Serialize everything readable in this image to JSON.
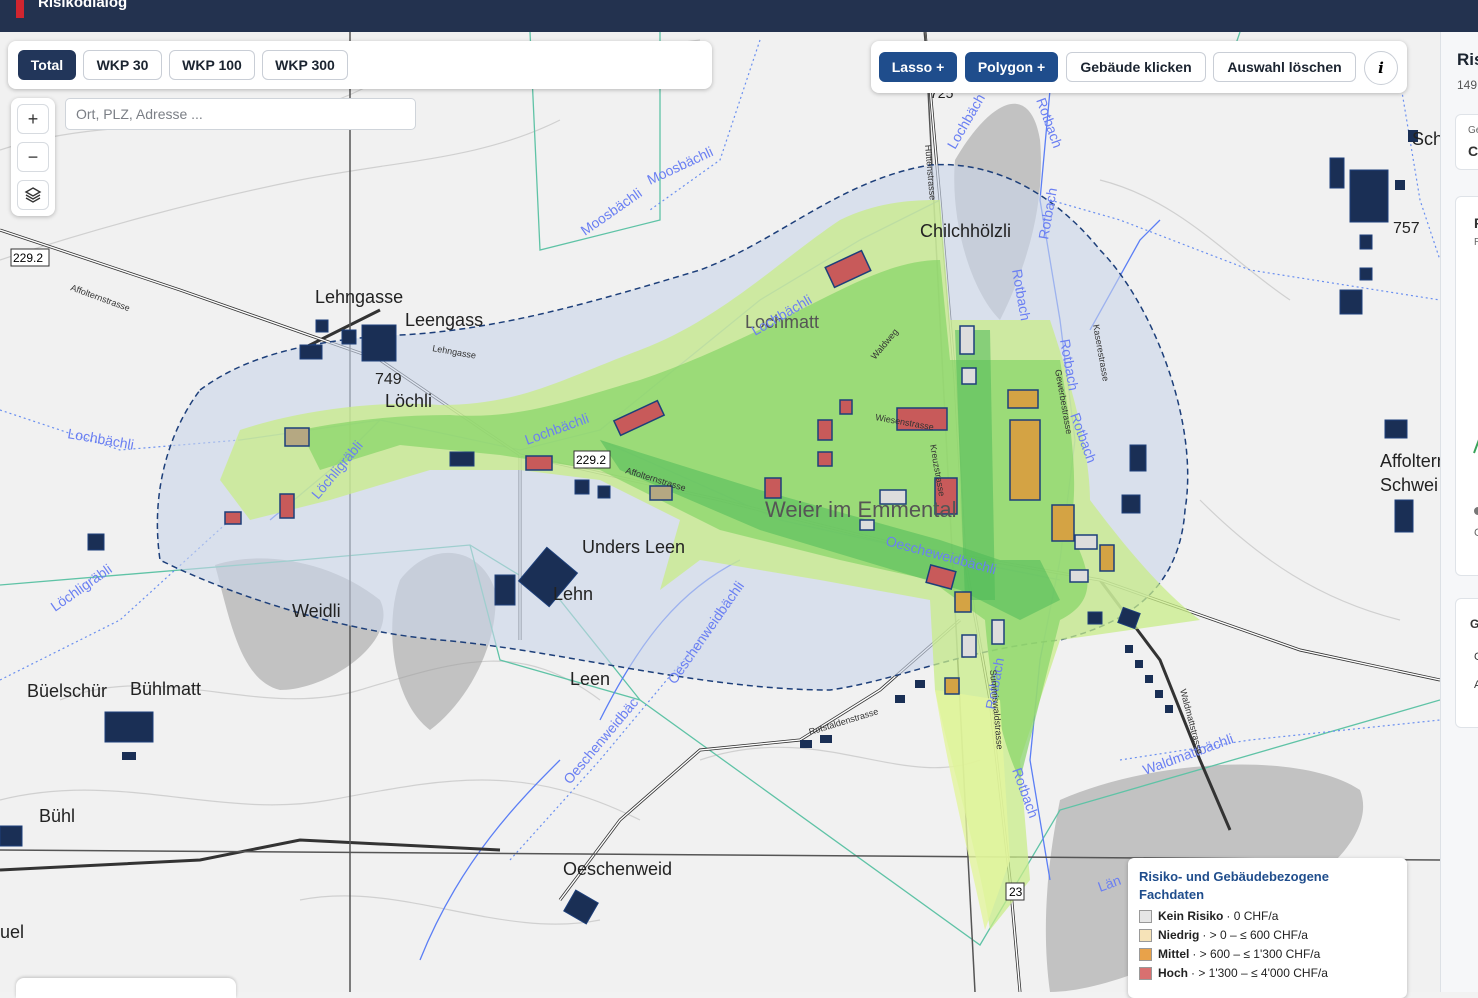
{
  "header": {
    "title": "Risikodialog"
  },
  "scenario_tabs": [
    "Total",
    "WKP 30",
    "WKP 100",
    "WKP 300"
  ],
  "active_tab": "Total",
  "search": {
    "placeholder": "Ort, PLZ, Adresse ..."
  },
  "zoom": {
    "in": "+",
    "out": "−",
    "layers_icon": "layers-icon"
  },
  "tools": {
    "lasso": "Lasso +",
    "polygon": "Polygon +",
    "click_buildings": "Gebäude klicken",
    "clear_selection": "Auswahl löschen",
    "info": "i"
  },
  "legend": {
    "title": "Risiko- und Gebäudebezogene Fachdaten",
    "items": [
      {
        "name": "Kein Risiko",
        "range": "· 0 CHF/a",
        "color": "#e6e6e6"
      },
      {
        "name": "Niedrig",
        "range": "· > 0 – ≤ 600 CHF/a",
        "color": "#f6e3b8"
      },
      {
        "name": "Mittel",
        "range": "· > 600 – ≤ 1'300 CHF/a",
        "color": "#e8a24a"
      },
      {
        "name": "Hoch",
        "range": "· > 1'300 – ≤ 4'000 CHF/a",
        "color": "#d87070"
      }
    ]
  },
  "side_panel": {
    "title": "Ris",
    "number": "149",
    "label_ge": "Ge",
    "value_ch": "Cł",
    "card2_r": "R",
    "card2_sub": "Ri",
    "card3_g": "G",
    "card3_g2": "G",
    "card3_a": "A"
  },
  "map_labels": {
    "places": [
      "Lehngasse",
      "Leengass",
      "Löchli",
      "Unders Leen",
      "Weidli",
      "Lehn",
      "Leen",
      "Büelschür",
      "Bühlmatt",
      "Bühl",
      "Oeschenweid",
      "Chilchhölzli",
      "Lochmatt",
      "Weier im Emmental",
      "Affoltern im Schwei",
      "Schw",
      "uel"
    ],
    "streams": [
      "Lochbächli",
      "Lochbächli",
      "Lochbächli",
      "Lochbächli",
      "Löchligräbli",
      "Löchligräbli",
      "Moosbächli",
      "Moosbächli",
      "Rotbach",
      "Rotbach",
      "Rotbach",
      "Rotbach",
      "Rotbach",
      "Rotbach",
      "Rotbach",
      "Oeschenweidbächli",
      "Oeschenweidbächli",
      "Oescheweidbächli",
      "Oeschenweidbäc",
      "Waldmattbächli",
      "Län"
    ],
    "roads": [
      "Affolternstrasse",
      "Affolternstrasse",
      "Rotstaldenstrasse",
      "Gewerbestrasse",
      "Kaserestrasse",
      "Waldmattstrasse",
      "Lehngasse",
      "Wiesenstrasse",
      "Kreuzstrasse",
      "Summiswaldstrasse",
      "Waldweg",
      "Hüttenstrasse"
    ],
    "numbers": [
      "229.2",
      "229.2",
      "749",
      "757",
      "725",
      "23"
    ]
  }
}
